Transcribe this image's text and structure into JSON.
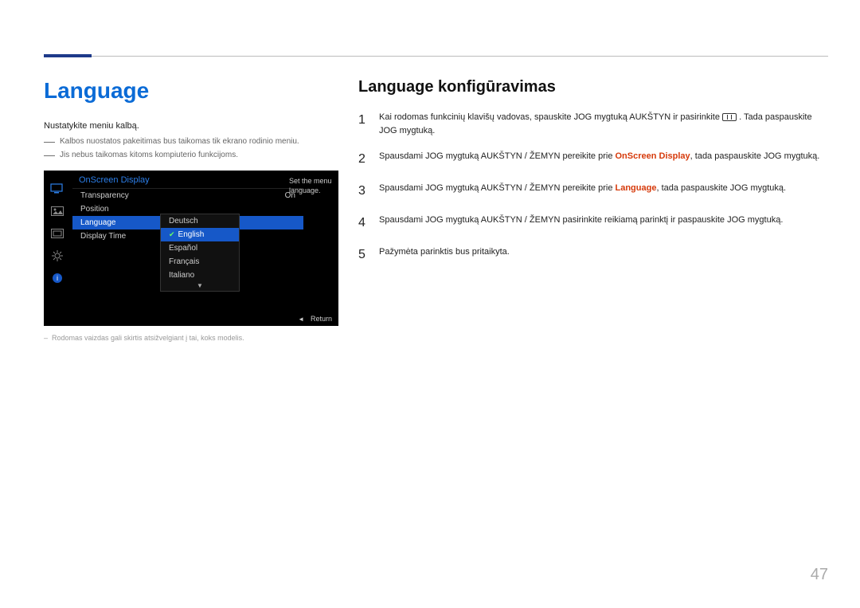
{
  "page_number": "47",
  "left": {
    "heading": "Language",
    "intro": "Nustatykite meniu kalbą.",
    "note1": "Kalbos nuostatos pakeitimas bus taikomas tik ekrano rodinio meniu.",
    "note2": "Jis nebus taikomas kitoms kompiuterio funkcijoms.",
    "image_note": "Rodomas vaizdas gali skirtis atsižvelgiant į tai, koks modelis."
  },
  "osd": {
    "title": "OnScreen Display",
    "help_line1": "Set the menu",
    "help_line2": "language.",
    "rows": [
      {
        "label": "Transparency",
        "value": "On"
      },
      {
        "label": "Position",
        "value": ""
      },
      {
        "label": "Language",
        "value": ""
      },
      {
        "label": "Display Time",
        "value": ""
      }
    ],
    "submenu": {
      "items": [
        "Deutsch",
        "English",
        "Español",
        "Français",
        "Italiano"
      ],
      "selected": "English"
    },
    "return_label": "Return"
  },
  "right": {
    "heading": "Language konfigūravimas",
    "steps": {
      "s1a": "Kai rodomas funkcinių klavišų vadovas, spauskite JOG mygtuką AUKŠTYN ir pasirinkite ",
      "s1b": ". Tada paspauskite JOG mygtuką.",
      "s2a": "Spausdami JOG mygtuką AUKŠTYN / ŽEMYN pereikite prie ",
      "s2hl": "OnScreen Display",
      "s2b": ", tada paspauskite JOG mygtuką.",
      "s3a": "Spausdami JOG mygtuką AUKŠTYN / ŽEMYN pereikite prie ",
      "s3hl": "Language",
      "s3b": ", tada paspauskite JOG mygtuką.",
      "s4": "Spausdami JOG mygtuką AUKŠTYN / ŽEMYN pasirinkite reikiamą parinktį ir paspauskite JOG mygtuką.",
      "s5": "Pažymėta parinktis bus pritaikyta."
    }
  }
}
